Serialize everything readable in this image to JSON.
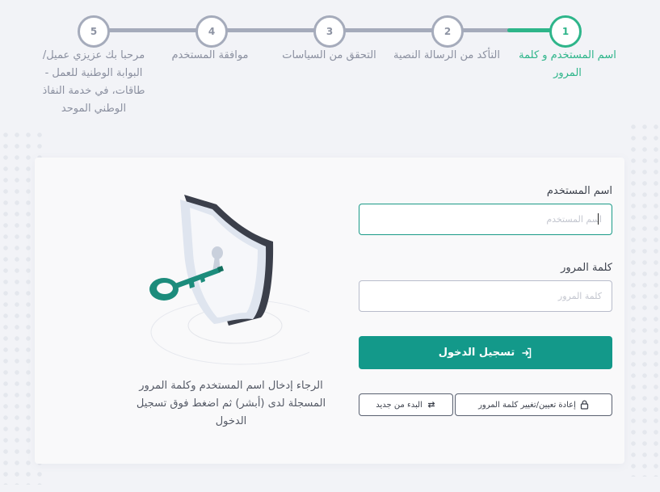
{
  "stepper": {
    "steps": [
      {
        "number": "1",
        "label": "اسم المستخدم و كلمة المرور",
        "active": true
      },
      {
        "number": "2",
        "label": "التأكد من الرسالة النصية",
        "active": false
      },
      {
        "number": "3",
        "label": "التحقق من السياسات",
        "active": false
      },
      {
        "number": "4",
        "label": "موافقة المستخدم",
        "active": false
      },
      {
        "number": "5",
        "label": "مرحبا بك عزيزي عميل/ البوابة الوطنية للعمل - طاقات، في خدمة النفاذ الوطني الموحد",
        "active": false
      }
    ]
  },
  "form": {
    "username_label": "اسم المستخدم",
    "username_placeholder": "اسم المستخدم",
    "username_value": "",
    "password_label": "كلمة المرور",
    "password_placeholder": "كلمة المرور",
    "password_value": "",
    "login_button": "تسجيل الدخول",
    "reset_password_button": "إعادة تعيين/تغيير كلمة المرور",
    "restart_button": "البدء من جديد"
  },
  "illustration": {
    "instruction": "الرجاء إدخال اسم المستخدم وكلمة المرور المسجلة لدى (أبشر) ثم اضغط فوق تسجيل الدخول"
  },
  "colors": {
    "accent": "#13998a",
    "active_step": "#2eb58a",
    "inactive_step": "#a5abbb"
  }
}
